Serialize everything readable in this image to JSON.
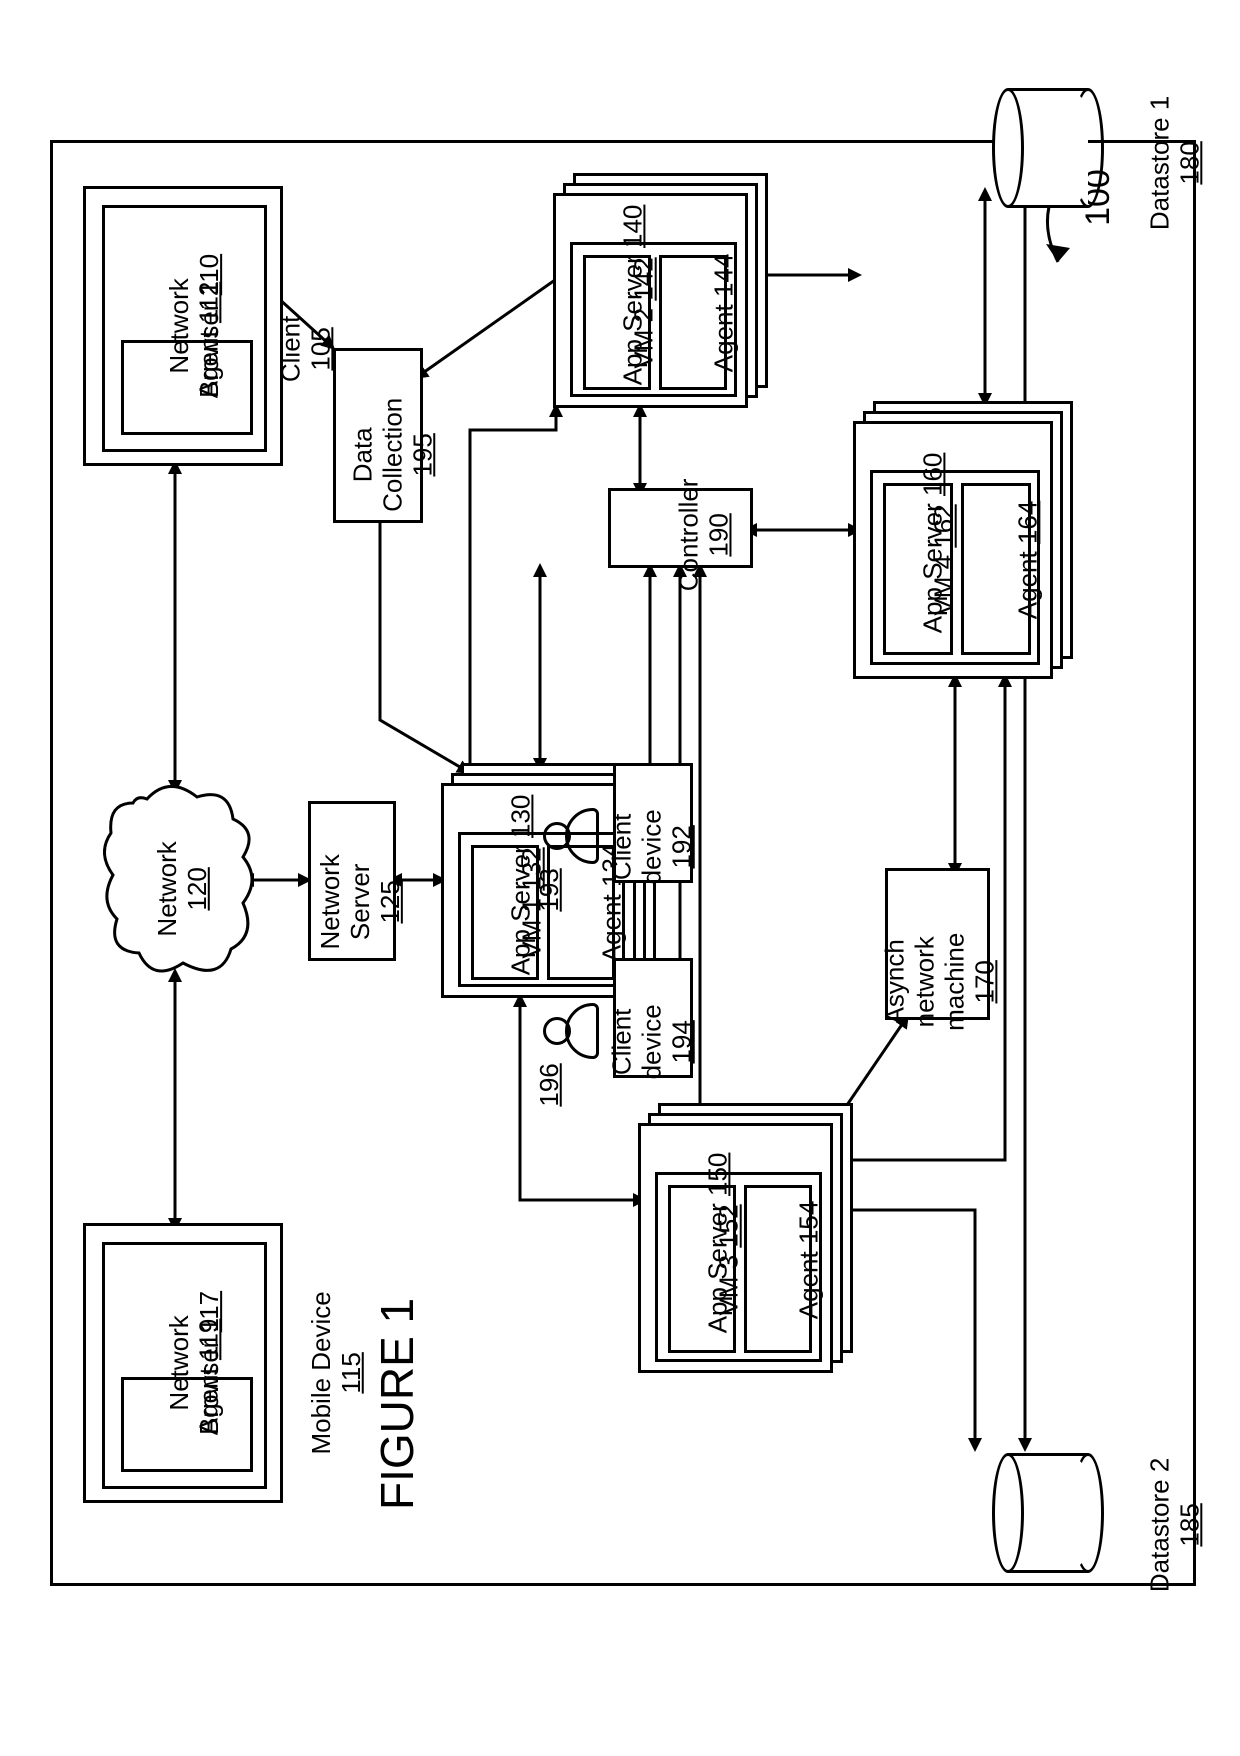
{
  "figure_label": "FIGURE 1",
  "system_ref": "100",
  "client": {
    "label": "Client",
    "ref": "105",
    "browser_label": "Network\nBrowser",
    "browser_ref": "110",
    "agent_label": "Agent",
    "agent_ref": "112"
  },
  "mobile": {
    "label": "Mobile Device",
    "ref": "115",
    "browser_label": "Network\nBrowser",
    "browser_ref": "117",
    "agent_label": "Agent",
    "agent_ref": "119"
  },
  "network": {
    "label": "Network",
    "ref": "120"
  },
  "network_server": {
    "label": "Network\nServer",
    "ref": "125"
  },
  "data_collection": {
    "label": "Data\nCollection",
    "ref": "195"
  },
  "controller": {
    "label": "Controller",
    "ref": "190"
  },
  "asynch": {
    "label": "Asynch\nnetwork\nmachine",
    "ref": "170"
  },
  "datastore1": {
    "label": "Datastore 1",
    "ref": "180"
  },
  "datastore2": {
    "label": "Datastore 2",
    "ref": "185"
  },
  "client_device1": {
    "label": "Client\ndevice",
    "ref": "192",
    "user_ref": "193"
  },
  "client_device2": {
    "label": "Client\ndevice",
    "ref": "194",
    "user_ref": "196"
  },
  "app_servers": {
    "s1": {
      "label": "App Server",
      "ref": "130",
      "vm_label": "VM 1",
      "vm_ref": "132",
      "agent_label": "Agent",
      "agent_ref": "134"
    },
    "s2": {
      "label": "App Server",
      "ref": "140",
      "vm_label": "VM 2",
      "vm_ref": "142",
      "agent_label": "Agent",
      "agent_ref": "144"
    },
    "s3": {
      "label": "App Server",
      "ref": "150",
      "vm_label": "VM 3",
      "vm_ref": "152",
      "agent_label": "Agent",
      "agent_ref": "154"
    },
    "s4": {
      "label": "App Server",
      "ref": "160",
      "vm_label": "VM 4",
      "vm_ref": "162",
      "agent_label": "Agent",
      "agent_ref": "164"
    }
  }
}
